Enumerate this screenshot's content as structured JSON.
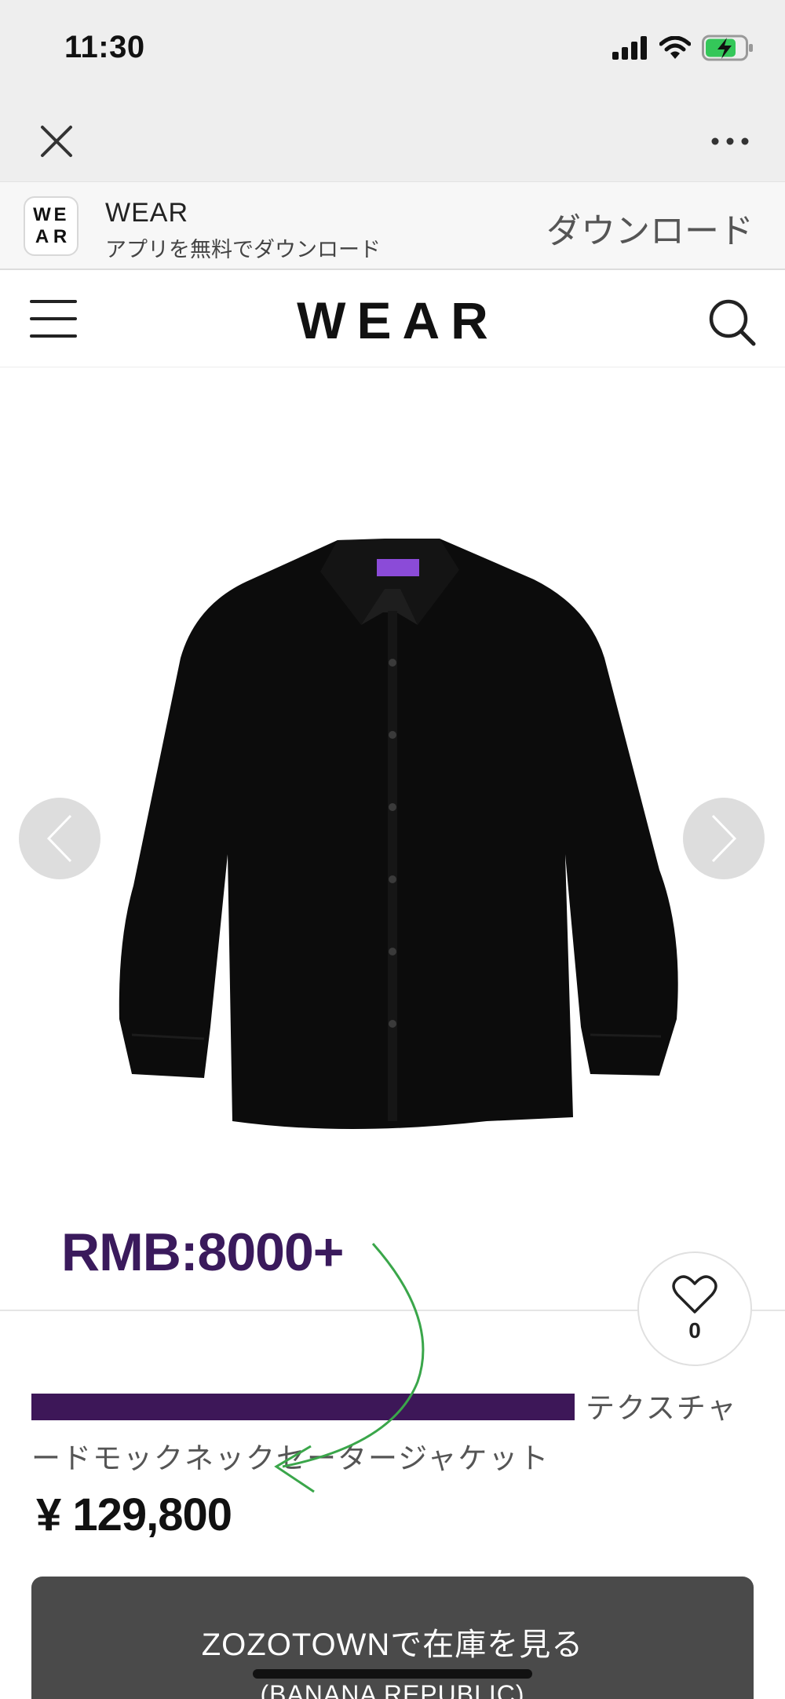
{
  "status_bar": {
    "time": "11:30"
  },
  "app_banner": {
    "logo_letters": [
      "W",
      "E",
      "A",
      "R"
    ],
    "name": "WEAR",
    "subtitle": "アプリを無料でダウンロード",
    "download_label": "ダウンロード"
  },
  "header": {
    "logo": "WEAR"
  },
  "overlay": {
    "price_note": "RMB:8000+"
  },
  "like": {
    "count": "0"
  },
  "product": {
    "title_visible": "テクスチャードモックネックセータージャケット",
    "price": "¥ 129,800"
  },
  "cta": {
    "label": "ZOZOTOWNで在庫を見る",
    "sub": "(BANANA REPUBLIC)"
  },
  "colors": {
    "overlay_text": "#3a1a5c",
    "redaction": "#3d1758",
    "annotation_arrow": "#3aa64a",
    "cta_background": "#4a4a4a"
  },
  "icons": [
    "close-icon",
    "more-icon",
    "hamburger-icon",
    "search-icon",
    "chevron-left-icon",
    "chevron-right-icon",
    "heart-icon"
  ]
}
